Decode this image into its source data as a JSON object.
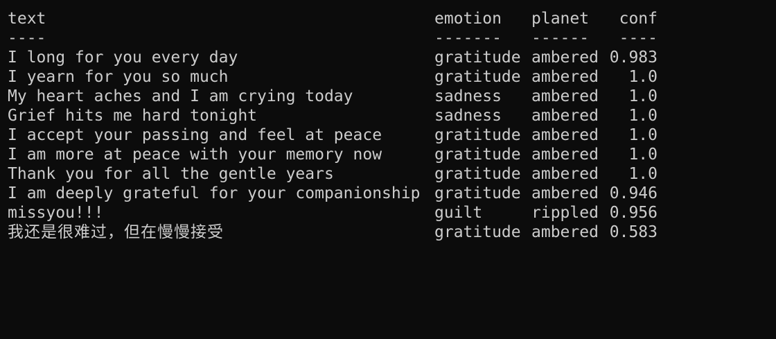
{
  "terminal": {
    "background": "#0c0c0c",
    "foreground": "#cccccc",
    "columns": {
      "text": "text",
      "emotion": "emotion",
      "planet": "planet",
      "conf": "conf"
    },
    "separators": {
      "text": "----",
      "emotion": "-------",
      "planet": "------",
      "conf": "----"
    },
    "rows": [
      {
        "text": "I long for you every day",
        "emotion": "gratitude",
        "planet": "ambered",
        "conf": "0.983"
      },
      {
        "text": "I yearn for you so much",
        "emotion": "gratitude",
        "planet": "ambered",
        "conf": "1.0"
      },
      {
        "text": "My heart aches and I am crying today",
        "emotion": "sadness",
        "planet": "ambered",
        "conf": "1.0"
      },
      {
        "text": "Grief hits me hard tonight",
        "emotion": "sadness",
        "planet": "ambered",
        "conf": "1.0"
      },
      {
        "text": "I accept your passing and feel at peace",
        "emotion": "gratitude",
        "planet": "ambered",
        "conf": "1.0"
      },
      {
        "text": "I am more at peace with your memory now",
        "emotion": "gratitude",
        "planet": "ambered",
        "conf": "1.0"
      },
      {
        "text": "Thank you for all the gentle years",
        "emotion": "gratitude",
        "planet": "ambered",
        "conf": "1.0"
      },
      {
        "text": "I am deeply grateful for your companionship",
        "emotion": "gratitude",
        "planet": "ambered",
        "conf": "0.946"
      },
      {
        "text": "missyou!!!",
        "emotion": "guilt",
        "planet": "rippled",
        "conf": "0.956"
      },
      {
        "text": "我还是很难过，但在慢慢接受",
        "emotion": "gratitude",
        "planet": "ambered",
        "conf": "0.583"
      }
    ]
  }
}
